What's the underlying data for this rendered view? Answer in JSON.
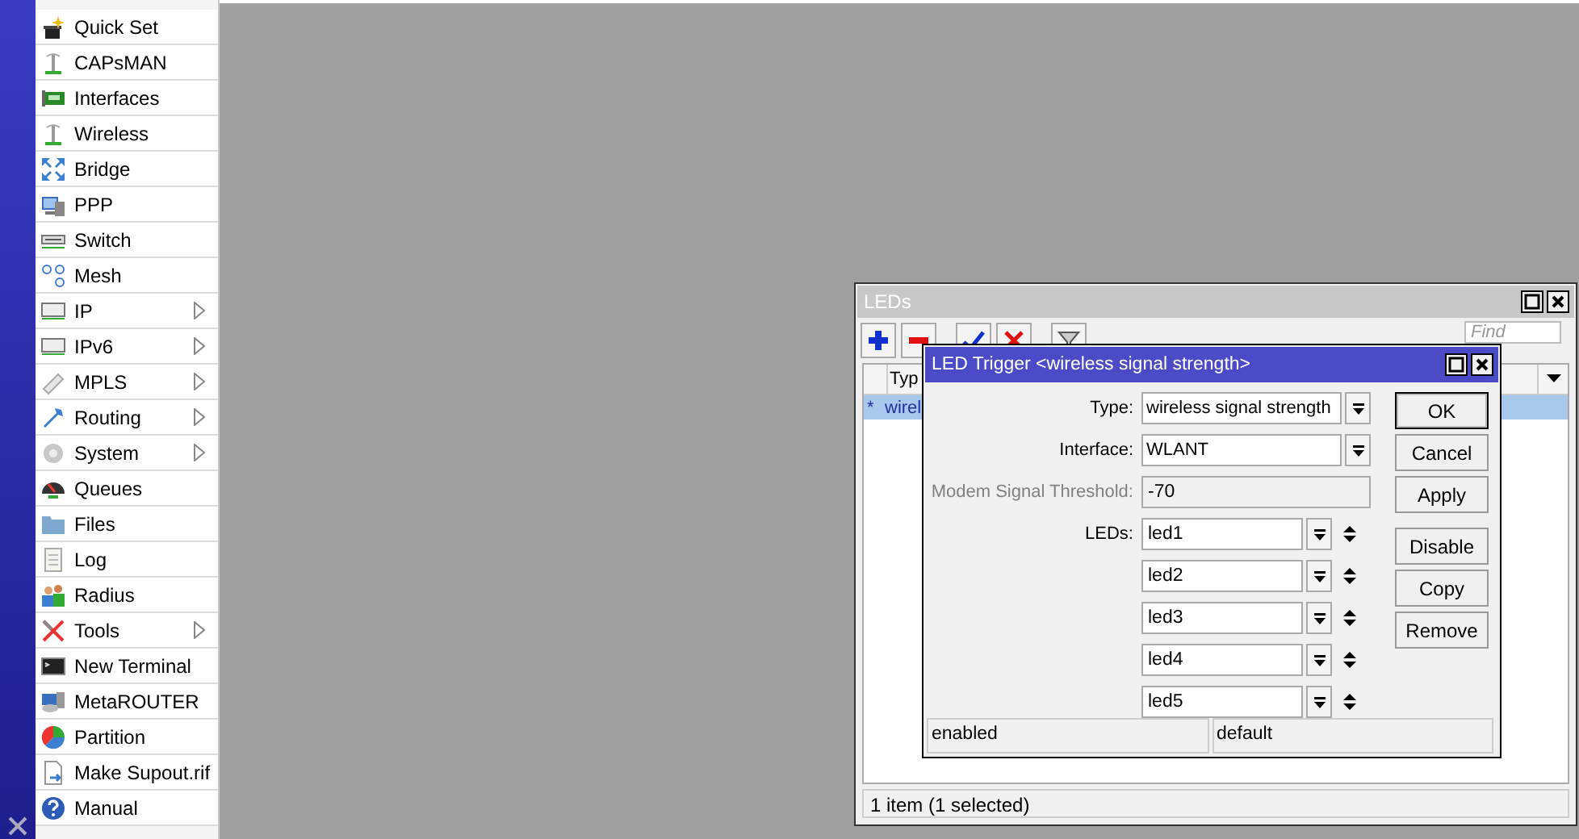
{
  "sidebar": {
    "items": [
      {
        "label": "Quick Set",
        "submenu": false
      },
      {
        "label": "CAPsMAN",
        "submenu": false
      },
      {
        "label": "Interfaces",
        "submenu": false
      },
      {
        "label": "Wireless",
        "submenu": false
      },
      {
        "label": "Bridge",
        "submenu": false
      },
      {
        "label": "PPP",
        "submenu": false
      },
      {
        "label": "Switch",
        "submenu": false
      },
      {
        "label": "Mesh",
        "submenu": false
      },
      {
        "label": "IP",
        "submenu": true
      },
      {
        "label": "IPv6",
        "submenu": true
      },
      {
        "label": "MPLS",
        "submenu": true
      },
      {
        "label": "Routing",
        "submenu": true
      },
      {
        "label": "System",
        "submenu": true
      },
      {
        "label": "Queues",
        "submenu": false
      },
      {
        "label": "Files",
        "submenu": false
      },
      {
        "label": "Log",
        "submenu": false
      },
      {
        "label": "Radius",
        "submenu": false
      },
      {
        "label": "Tools",
        "submenu": true
      },
      {
        "label": "New Terminal",
        "submenu": false
      },
      {
        "label": "MetaROUTER",
        "submenu": false
      },
      {
        "label": "Partition",
        "submenu": false
      },
      {
        "label": "Make Supout.rif",
        "submenu": false
      },
      {
        "label": "Manual",
        "submenu": false
      }
    ]
  },
  "leds_window": {
    "title": "LEDs",
    "find": {
      "placeholder": "Find"
    },
    "table": {
      "columns": [
        "Typ"
      ],
      "rows": [
        {
          "marker": "*",
          "type": "wirel",
          "selected": true
        }
      ]
    },
    "status_bar": "1 item (1 selected)"
  },
  "dialog": {
    "title": "LED Trigger <wireless signal strength>",
    "fields": [
      {
        "label": "Type:",
        "value": "wireless signal strength",
        "kind": "dropdown",
        "disabled": false
      },
      {
        "label": "Interface:",
        "value": "WLANT",
        "kind": "dropdown",
        "disabled": false
      },
      {
        "label": "Modem Signal Threshold:",
        "value": "-70",
        "kind": "text",
        "disabled": true
      }
    ],
    "leds": {
      "label": "LEDs:",
      "values": [
        "led1",
        "led2",
        "led3",
        "led4",
        "led5"
      ]
    },
    "buttons": [
      {
        "label": "OK",
        "default": true
      },
      {
        "label": "Cancel",
        "default": false
      },
      {
        "label": "Apply",
        "default": false
      },
      {
        "label": "Disable",
        "default": false
      },
      {
        "label": "Copy",
        "default": false
      },
      {
        "label": "Remove",
        "default": false
      }
    ],
    "status_bar": [
      "enabled",
      "default"
    ]
  }
}
